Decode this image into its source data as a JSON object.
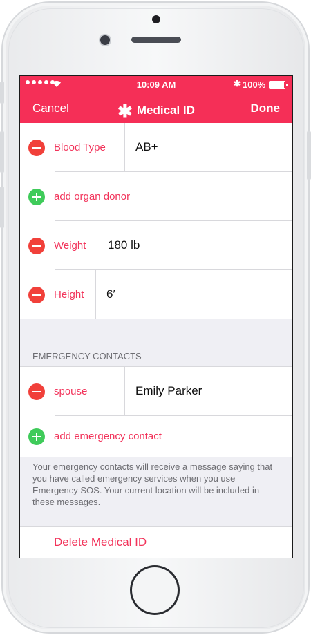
{
  "status": {
    "time": "10:09 AM",
    "battery": "100%"
  },
  "nav": {
    "cancel": "Cancel",
    "title": "Medical ID",
    "done": "Done"
  },
  "fields": [
    {
      "label": "Blood Type",
      "value": "AB+"
    },
    {
      "add_label": "add organ donor"
    },
    {
      "label": "Weight",
      "value": "180 lb"
    },
    {
      "label": "Height",
      "value": "6′"
    }
  ],
  "contacts": {
    "header": "EMERGENCY CONTACTS",
    "items": [
      {
        "label": "spouse",
        "value": "Emily Parker"
      }
    ],
    "add_label": "add emergency contact",
    "footer": "Your emergency contacts will receive a message saying that you have called emergency services when you use Emergency SOS. Your current location will be included in these messages."
  },
  "delete_label": "Delete Medical ID",
  "colors": {
    "accent": "#f52f57",
    "delete": "#f1403a",
    "add": "#3fcb5a"
  },
  "icons": {
    "nav_title": "asterisk-icon"
  }
}
